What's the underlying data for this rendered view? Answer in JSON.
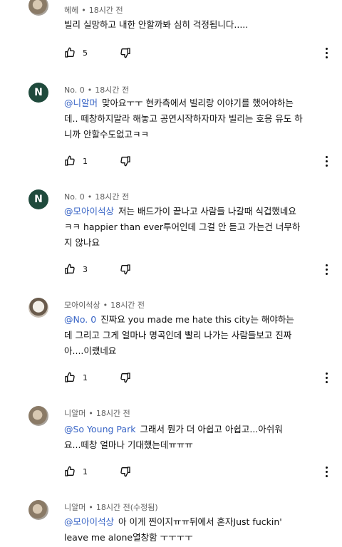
{
  "comments": [
    {
      "author": "헤헤",
      "time": "18시간 전",
      "mention": "",
      "lines": [
        "빌리 실망하고 내한 안할까봐 심히 걱정됩니다....."
      ],
      "likes": "5"
    },
    {
      "author": "No. 0",
      "avatar_letter": "N",
      "time": "18시간 전",
      "mention": "@니알머",
      "lines": [
        "맞아요ㅜㅜ 현카측에서 빌리랑 이야기를 했어야하는",
        "데.. 떼창하지말라 해놓고 공연시작하자마자 빌리는 호응 유도 하",
        "니까 안할수도없고ㅋㅋ"
      ],
      "likes": "1"
    },
    {
      "author": "No. 0",
      "avatar_letter": "N",
      "time": "18시간 전",
      "mention": "@모아이석상",
      "lines": [
        "저는 배드가이 끝나고 사람들 나갈때 식겁했네요",
        "ㅋㅋ happier than ever투어인데 그걸 안 듣고 가는건 너무하",
        "지 않나요"
      ],
      "likes": "3"
    },
    {
      "author": "모아이석상",
      "time": "18시간 전",
      "mention": "@No. 0",
      "lines": [
        "진짜요 you made me hate this city는 해야하는",
        "데 그리고 그게 얼마나 명곡인데 빨리 나가는 사람들보고 진짜",
        "아....이랬네요"
      ],
      "likes": "1"
    },
    {
      "author": "니알머",
      "time": "18시간 전",
      "mention": "@So Young Park",
      "lines": [
        "그래서 뭔가 더 아쉽고 아쉽고...아쉬워",
        "요...떼창 얼마나 기대했는데ㅠㅠㅠ"
      ],
      "likes": "1"
    },
    {
      "author": "니알머",
      "time": "18시간 전(수정됨)",
      "mention": "@모아이석상",
      "lines": [
        "아 이게 찐이지ㅠㅠ뒤에서 혼자Just fuckin'",
        "leave me alone열창함 ㅜㅜㅜㅜ"
      ],
      "likes": ""
    }
  ],
  "icons": {
    "like": "thumbs-up-icon",
    "dislike": "thumbs-down-icon",
    "more": "more-vertical-icon"
  }
}
